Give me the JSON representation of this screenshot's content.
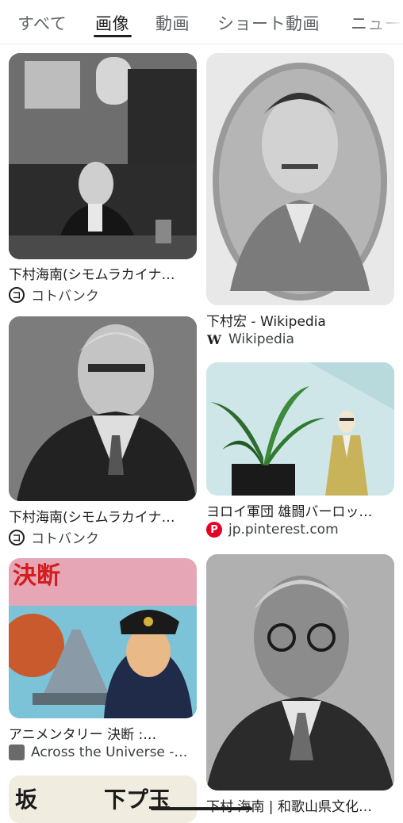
{
  "tabs": [
    {
      "label": "すべて",
      "active": false
    },
    {
      "label": "画像",
      "active": true
    },
    {
      "label": "動画",
      "active": false
    },
    {
      "label": "ショート動画",
      "active": false
    },
    {
      "label": "ニュー",
      "active": false
    }
  ],
  "results": [
    {
      "title": "下村海南(シモムラカイナ…",
      "source": "コトバンク",
      "favicon": "kotobank-icon"
    },
    {
      "title": "下村宏 - Wikipedia",
      "source": "Wikipedia",
      "favicon": "wikipedia-icon"
    },
    {
      "title": "下村海南(シモムラカイナ…",
      "source": "コトバンク",
      "favicon": "kotobank-icon"
    },
    {
      "title": "ヨロイ軍団 雄闘バーロッ…",
      "source": "jp.pinterest.com",
      "favicon": "pinterest-icon"
    },
    {
      "title": "アニメンタリー 決断 :…",
      "source": "Across the Universe -…",
      "favicon": "across-universe-icon"
    },
    {
      "title": "下村 海南 | 和歌山県文化…",
      "source": "",
      "favicon": ""
    }
  ],
  "poster_text": {
    "kessen": "決断",
    "bottom_thumb": "坂",
    "bottom_thumb_2": "下プ玉"
  },
  "favicon_glyphs": {
    "kotobank": "コ",
    "wikipedia": "W",
    "pinterest": "P"
  }
}
